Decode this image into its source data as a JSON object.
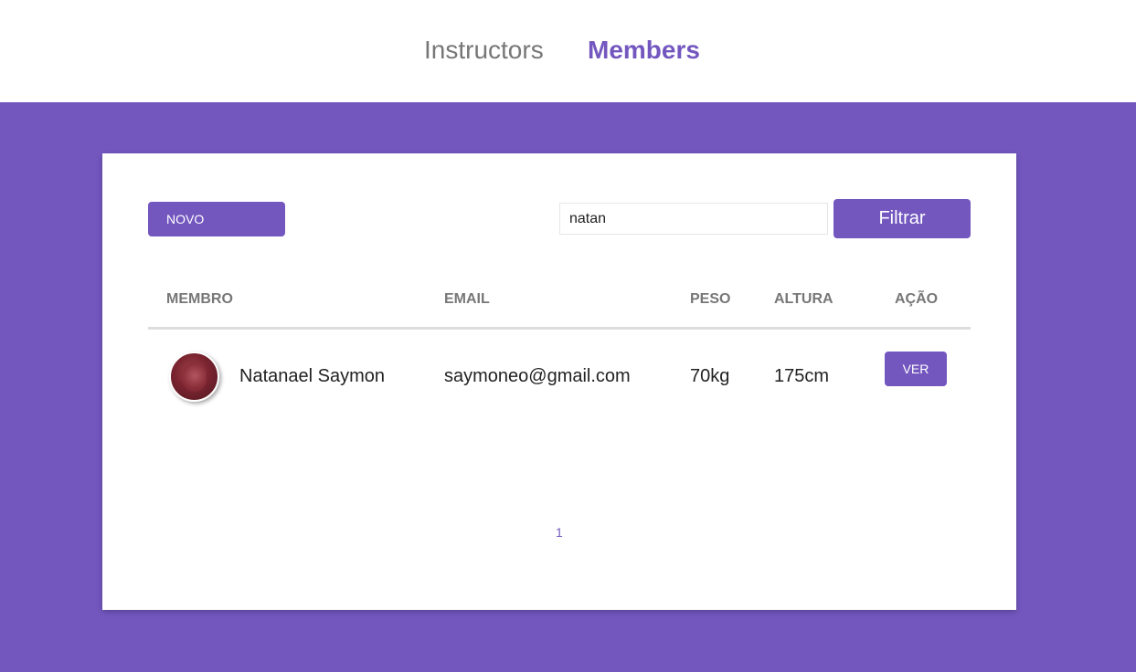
{
  "nav": {
    "instructors_label": "Instructors",
    "members_label": "Members",
    "active": "Members"
  },
  "toolbar": {
    "new_label": "NOVO",
    "search_value": "natan",
    "filter_label": "Filtrar"
  },
  "table": {
    "headers": [
      "MEMBRO",
      "EMAIL",
      "PESO",
      "ALTURA",
      "AÇÃO"
    ],
    "rows": [
      {
        "name": "Natanael Saymon",
        "email": "saymoneo@gmail.com",
        "peso": "70kg",
        "altura": "175cm",
        "action_label": "VER"
      }
    ]
  },
  "pagination": {
    "pages": [
      "1"
    ]
  },
  "colors": {
    "accent": "#7357bf",
    "background": "#7357bf",
    "card": "#ffffff",
    "muted_text": "#777777"
  },
  "icons": {
    "avatar": "user-avatar-photo"
  }
}
